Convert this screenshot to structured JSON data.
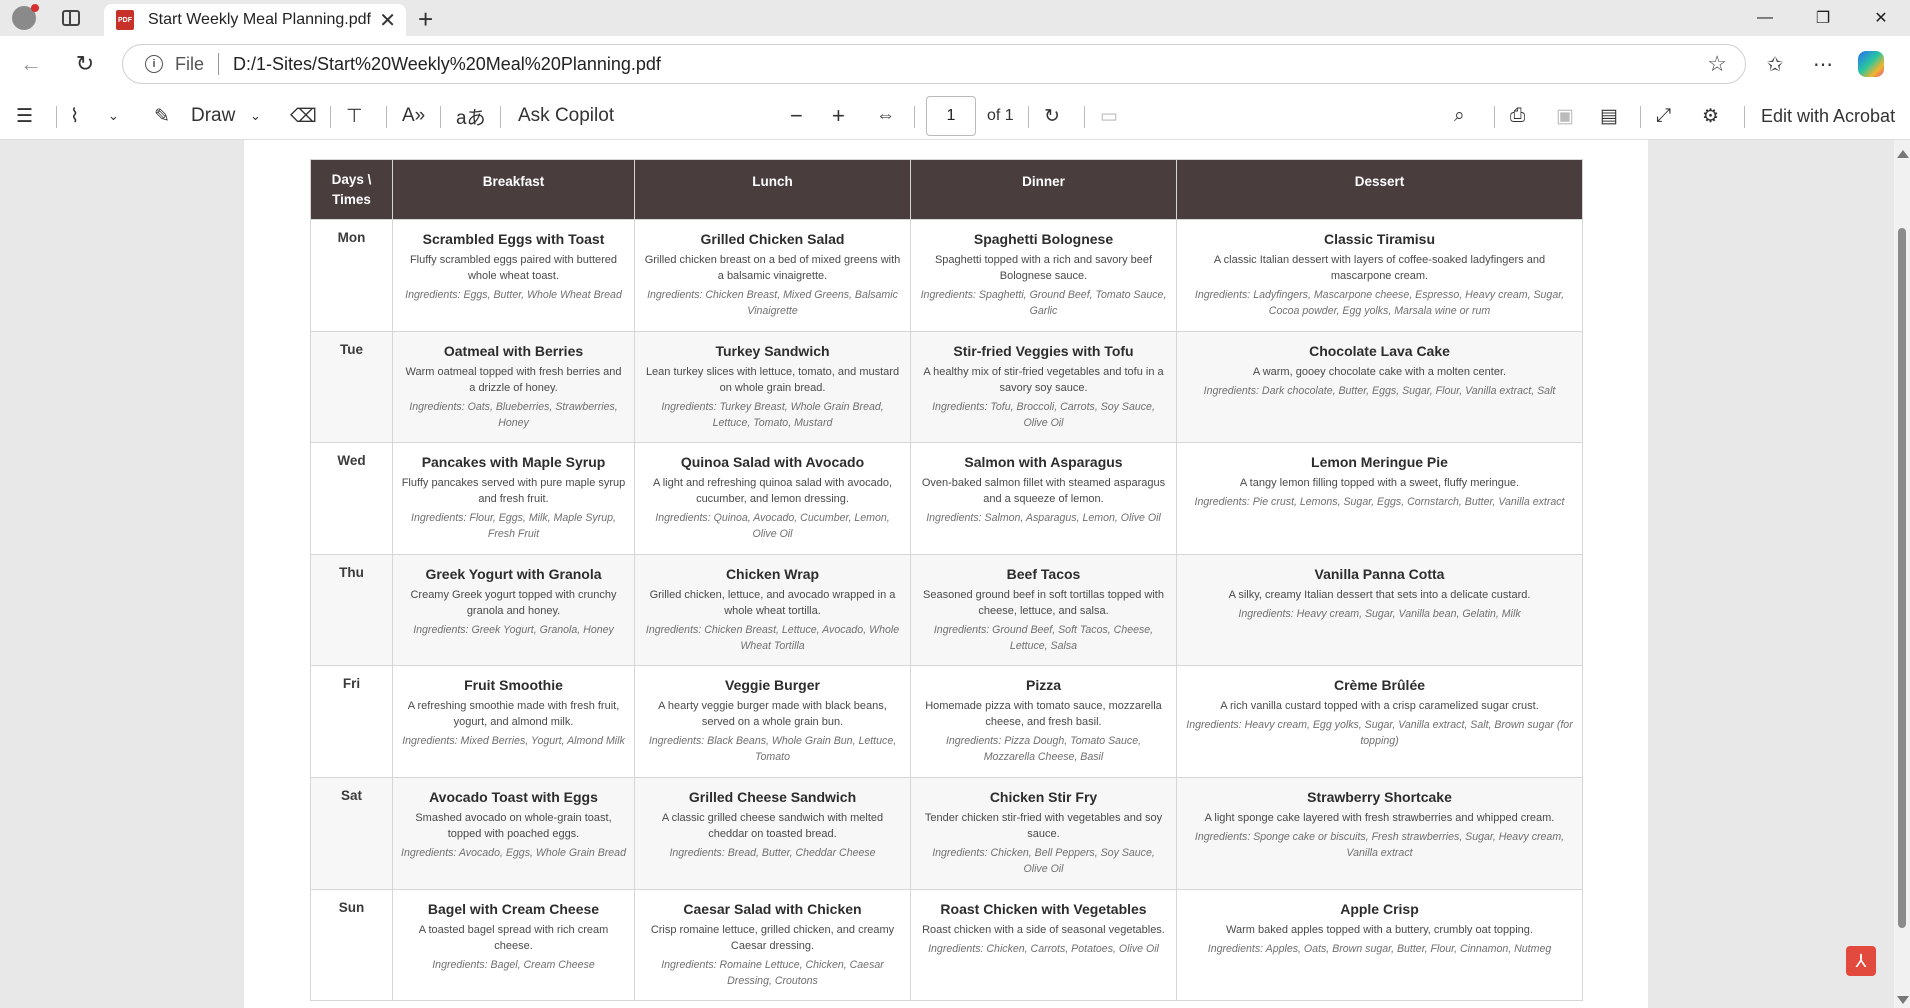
{
  "browser": {
    "tab_title": "Start Weekly Meal Planning.pdf",
    "favicon_label": "PDF",
    "address_scheme": "File",
    "address_url": "D:/1-Sites/Start%20Weekly%20Meal%20Planning.pdf"
  },
  "toolbar": {
    "draw_label": "Draw",
    "ask_copilot_label": "Ask Copilot",
    "page_number": "1",
    "page_total": "of 1",
    "edit_acrobat_label": "Edit with Acrobat",
    "translate_glyph": "aあ",
    "read_aloud_glyph": "A»"
  },
  "table": {
    "headers": [
      "Days \\ Times",
      "Breakfast",
      "Lunch",
      "Dinner",
      "Dessert"
    ],
    "rows": [
      {
        "day": "Mon",
        "meals": [
          {
            "name": "Scrambled Eggs with Toast",
            "desc": "Fluffy scrambled eggs paired with buttered whole wheat toast.",
            "ingredients": "Ingredients: Eggs, Butter, Whole Wheat Bread"
          },
          {
            "name": "Grilled Chicken Salad",
            "desc": "Grilled chicken breast on a bed of mixed greens with a balsamic vinaigrette.",
            "ingredients": "Ingredients: Chicken Breast, Mixed Greens, Balsamic Vinaigrette"
          },
          {
            "name": "Spaghetti Bolognese",
            "desc": "Spaghetti topped with a rich and savory beef Bolognese sauce.",
            "ingredients": "Ingredients: Spaghetti, Ground Beef, Tomato Sauce, Garlic"
          },
          {
            "name": "Classic Tiramisu",
            "desc": "A classic Italian dessert with layers of coffee-soaked ladyfingers and mascarpone cream.",
            "ingredients": "Ingredients: Ladyfingers, Mascarpone cheese, Espresso, Heavy cream, Sugar, Cocoa powder, Egg yolks, Marsala wine or rum"
          }
        ]
      },
      {
        "day": "Tue",
        "meals": [
          {
            "name": "Oatmeal with Berries",
            "desc": "Warm oatmeal topped with fresh berries and a drizzle of honey.",
            "ingredients": "Ingredients: Oats, Blueberries, Strawberries, Honey"
          },
          {
            "name": "Turkey Sandwich",
            "desc": "Lean turkey slices with lettuce, tomato, and mustard on whole grain bread.",
            "ingredients": "Ingredients: Turkey Breast, Whole Grain Bread, Lettuce, Tomato, Mustard"
          },
          {
            "name": "Stir-fried Veggies with Tofu",
            "desc": "A healthy mix of stir-fried vegetables and tofu in a savory soy sauce.",
            "ingredients": "Ingredients: Tofu, Broccoli, Carrots, Soy Sauce, Olive Oil"
          },
          {
            "name": "Chocolate Lava Cake",
            "desc": "A warm, gooey chocolate cake with a molten center.",
            "ingredients": "Ingredients: Dark chocolate, Butter, Eggs, Sugar, Flour, Vanilla extract, Salt"
          }
        ]
      },
      {
        "day": "Wed",
        "meals": [
          {
            "name": "Pancakes with Maple Syrup",
            "desc": "Fluffy pancakes served with pure maple syrup and fresh fruit.",
            "ingredients": "Ingredients: Flour, Eggs, Milk, Maple Syrup, Fresh Fruit"
          },
          {
            "name": "Quinoa Salad with Avocado",
            "desc": "A light and refreshing quinoa salad with avocado, cucumber, and lemon dressing.",
            "ingredients": "Ingredients: Quinoa, Avocado, Cucumber, Lemon, Olive Oil"
          },
          {
            "name": "Salmon with Asparagus",
            "desc": "Oven-baked salmon fillet with steamed asparagus and a squeeze of lemon.",
            "ingredients": "Ingredients: Salmon, Asparagus, Lemon, Olive Oil"
          },
          {
            "name": "Lemon Meringue Pie",
            "desc": "A tangy lemon filling topped with a sweet, fluffy meringue.",
            "ingredients": "Ingredients: Pie crust, Lemons, Sugar, Eggs, Cornstarch, Butter, Vanilla extract"
          }
        ]
      },
      {
        "day": "Thu",
        "meals": [
          {
            "name": "Greek Yogurt with Granola",
            "desc": "Creamy Greek yogurt topped with crunchy granola and honey.",
            "ingredients": "Ingredients: Greek Yogurt, Granola, Honey"
          },
          {
            "name": "Chicken Wrap",
            "desc": "Grilled chicken, lettuce, and avocado wrapped in a whole wheat tortilla.",
            "ingredients": "Ingredients: Chicken Breast, Lettuce, Avocado, Whole Wheat Tortilla"
          },
          {
            "name": "Beef Tacos",
            "desc": "Seasoned ground beef in soft tortillas topped with cheese, lettuce, and salsa.",
            "ingredients": "Ingredients: Ground Beef, Soft Tacos, Cheese, Lettuce, Salsa"
          },
          {
            "name": "Vanilla Panna Cotta",
            "desc": "A silky, creamy Italian dessert that sets into a delicate custard.",
            "ingredients": "Ingredients: Heavy cream, Sugar, Vanilla bean, Gelatin, Milk"
          }
        ]
      },
      {
        "day": "Fri",
        "meals": [
          {
            "name": "Fruit Smoothie",
            "desc": "A refreshing smoothie made with fresh fruit, yogurt, and almond milk.",
            "ingredients": "Ingredients: Mixed Berries, Yogurt, Almond Milk"
          },
          {
            "name": "Veggie Burger",
            "desc": "A hearty veggie burger made with black beans, served on a whole grain bun.",
            "ingredients": "Ingredients: Black Beans, Whole Grain Bun, Lettuce, Tomato"
          },
          {
            "name": "Pizza",
            "desc": "Homemade pizza with tomato sauce, mozzarella cheese, and fresh basil.",
            "ingredients": "Ingredients: Pizza Dough, Tomato Sauce, Mozzarella Cheese, Basil"
          },
          {
            "name": "Crème Brûlée",
            "desc": "A rich vanilla custard topped with a crisp caramelized sugar crust.",
            "ingredients": "Ingredients: Heavy cream, Egg yolks, Sugar, Vanilla extract, Salt, Brown sugar (for topping)"
          }
        ]
      },
      {
        "day": "Sat",
        "meals": [
          {
            "name": "Avocado Toast with Eggs",
            "desc": "Smashed avocado on whole-grain toast, topped with poached eggs.",
            "ingredients": "Ingredients: Avocado, Eggs, Whole Grain Bread"
          },
          {
            "name": "Grilled Cheese Sandwich",
            "desc": "A classic grilled cheese sandwich with melted cheddar on toasted bread.",
            "ingredients": "Ingredients: Bread, Butter, Cheddar Cheese"
          },
          {
            "name": "Chicken Stir Fry",
            "desc": "Tender chicken stir-fried with vegetables and soy sauce.",
            "ingredients": "Ingredients: Chicken, Bell Peppers, Soy Sauce, Olive Oil"
          },
          {
            "name": "Strawberry Shortcake",
            "desc": "A light sponge cake layered with fresh strawberries and whipped cream.",
            "ingredients": "Ingredients: Sponge cake or biscuits, Fresh strawberries, Sugar, Heavy cream, Vanilla extract"
          }
        ]
      },
      {
        "day": "Sun",
        "meals": [
          {
            "name": "Bagel with Cream Cheese",
            "desc": "A toasted bagel spread with rich cream cheese.",
            "ingredients": "Ingredients: Bagel, Cream Cheese"
          },
          {
            "name": "Caesar Salad with Chicken",
            "desc": "Crisp romaine lettuce, grilled chicken, and creamy Caesar dressing.",
            "ingredients": "Ingredients: Romaine Lettuce, Chicken, Caesar Dressing, Croutons"
          },
          {
            "name": "Roast Chicken with Vegetables",
            "desc": "Roast chicken with a side of seasonal vegetables.",
            "ingredients": "Ingredients: Chicken, Carrots, Potatoes, Olive Oil"
          },
          {
            "name": "Apple Crisp",
            "desc": "Warm baked apples topped with a buttery, crumbly oat topping.",
            "ingredients": "Ingredients: Apples, Oats, Brown sugar, Butter, Flour, Cinnamon, Nutmeg"
          }
        ]
      }
    ]
  },
  "colors": {
    "header_bg": "#4a3d3d",
    "acrobat_red": "#e34a3e"
  }
}
